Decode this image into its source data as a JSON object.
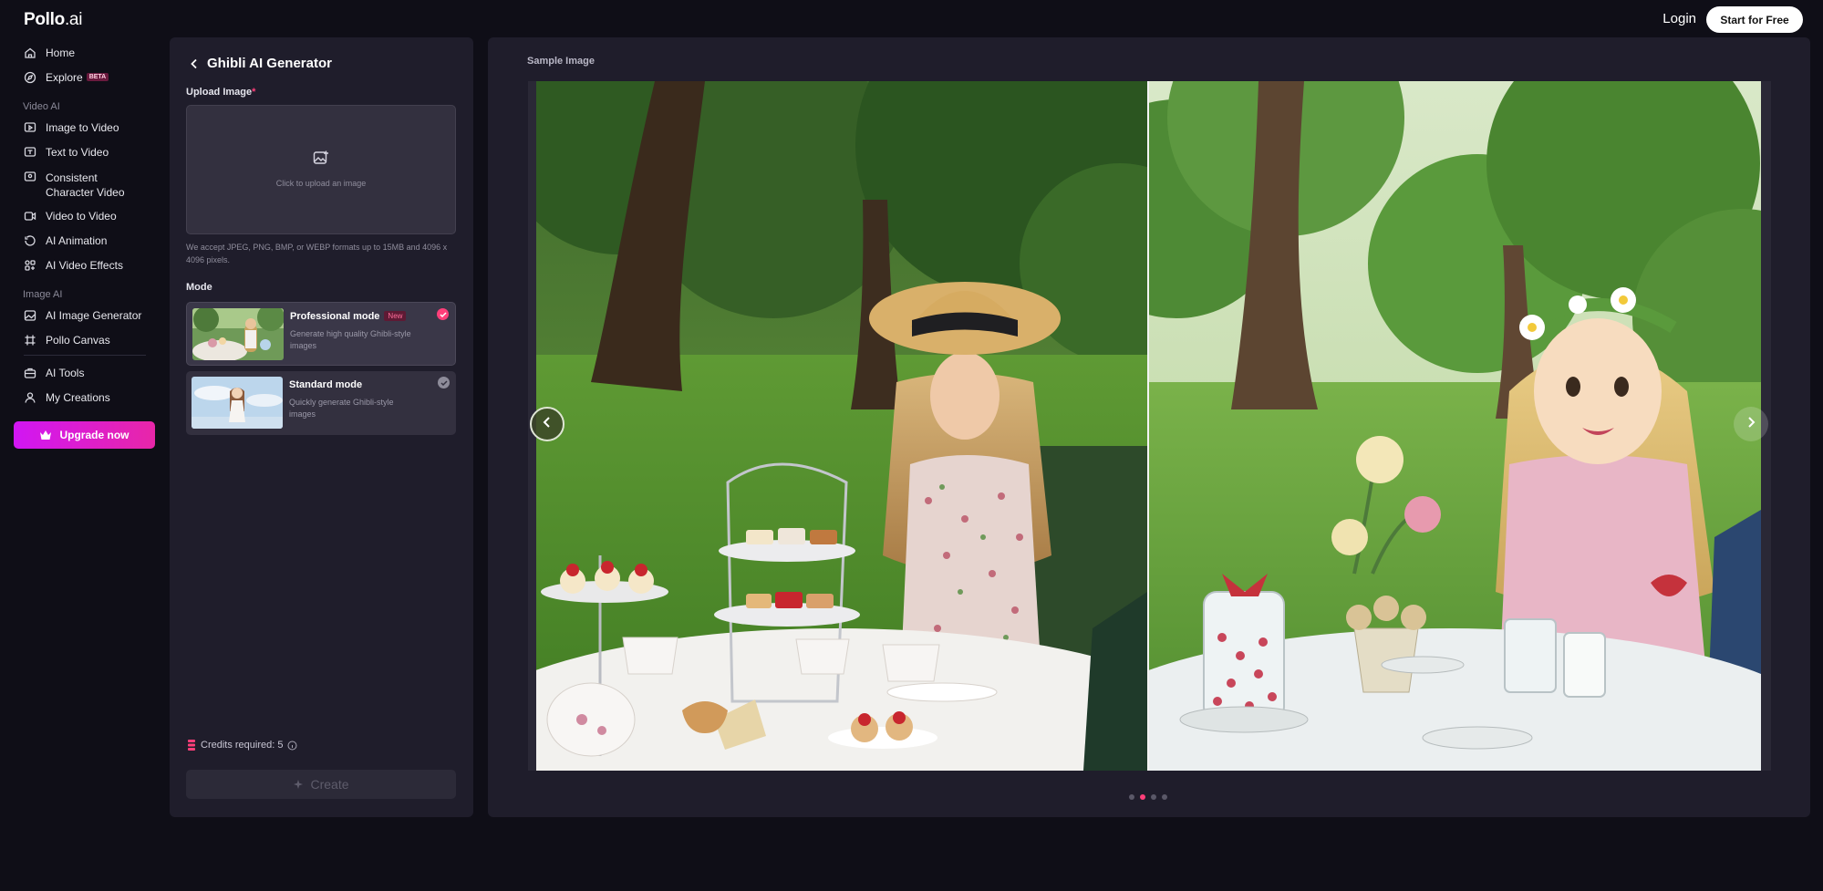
{
  "header": {
    "logo_main": "Pollo",
    "logo_suffix": ".ai",
    "login_label": "Login",
    "start_label": "Start for Free"
  },
  "sidebar": {
    "home": "Home",
    "explore": "Explore",
    "explore_badge": "BETA",
    "video_ai_label": "Video AI",
    "image_to_video": "Image to Video",
    "text_to_video": "Text to Video",
    "consistent_line1": "Consistent",
    "consistent_line2": "Character Video",
    "video_to_video": "Video to Video",
    "ai_animation": "AI Animation",
    "ai_video_effects": "AI Video Effects",
    "image_ai_label": "Image AI",
    "ai_image_generator": "AI Image Generator",
    "pollo_canvas": "Pollo Canvas",
    "ai_tools": "AI Tools",
    "my_creations": "My Creations",
    "upgrade_label": "Upgrade now"
  },
  "panel": {
    "title": "Ghibli AI Generator",
    "upload_label": "Upload Image",
    "required_mark": "*",
    "upload_hint": "Click to upload an image",
    "accept_text": "We accept JPEG, PNG, BMP, or WEBP formats up to 15MB and 4096 x 4096 pixels.",
    "mode_label": "Mode",
    "modes": [
      {
        "title": "Professional mode",
        "badge": "New",
        "desc": "Generate high quality Ghibli-style images",
        "selected": true
      },
      {
        "title": "Standard mode",
        "desc": "Quickly generate Ghibli-style images",
        "selected": false
      }
    ],
    "credits_text": "Credits required: 5",
    "create_label": "Create"
  },
  "main": {
    "sample_label": "Sample Image",
    "carousel": {
      "total": 4,
      "active_index": 1
    }
  },
  "colors": {
    "accent": "#ff3f7a",
    "upgrade_gradient_start": "#d116f3",
    "upgrade_gradient_end": "#e826a8",
    "panel_bg": "#1f1d2b",
    "page_bg": "#0f0e17"
  }
}
